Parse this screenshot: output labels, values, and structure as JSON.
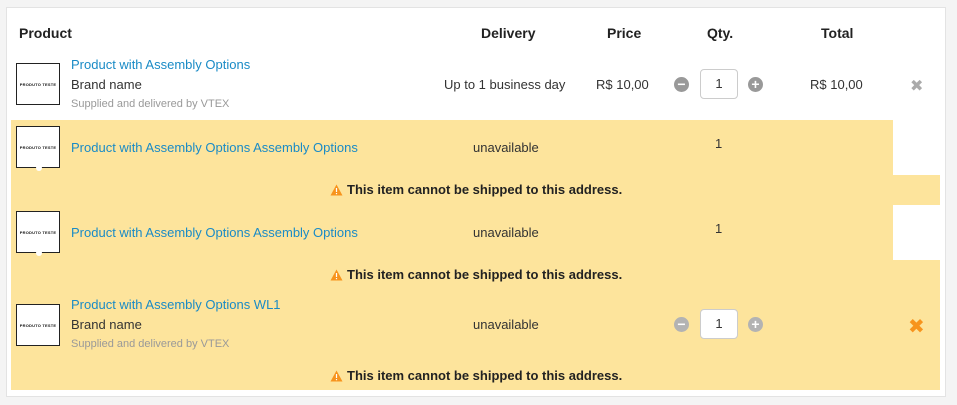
{
  "header": {
    "product": "Product",
    "delivery": "Delivery",
    "price": "Price",
    "qty": "Qty.",
    "total": "Total"
  },
  "thumb_text": "PRODUTO TESTE",
  "warning": "This item cannot be shipped to this address.",
  "items": [
    {
      "name": "Product with Assembly Options",
      "brand": "Brand name",
      "seller": "Supplied and delivered by VTEX",
      "delivery": "Up to 1 business day",
      "price": "R$ 10,00",
      "qty": "1",
      "total": "R$ 10,00"
    },
    {
      "name": "Product with Assembly Options Assembly Options",
      "delivery": "unavailable",
      "qty": "1"
    },
    {
      "name": "Product with Assembly Options Assembly Options",
      "delivery": "unavailable",
      "qty": "1"
    },
    {
      "name": "Product with Assembly Options WL1",
      "brand": "Brand name",
      "seller": "Supplied and delivered by VTEX",
      "delivery": "unavailable",
      "qty": "1"
    }
  ],
  "colors": {
    "unavailable_bg": "#fde49c",
    "link": "#1a8bc6",
    "remove_active": "#f7941d",
    "remove_muted": "#aaaaaa"
  },
  "icons": {
    "minus": "minus-circle-icon",
    "plus": "plus-circle-icon",
    "remove": "close-icon",
    "warning": "warning-triangle-icon"
  }
}
